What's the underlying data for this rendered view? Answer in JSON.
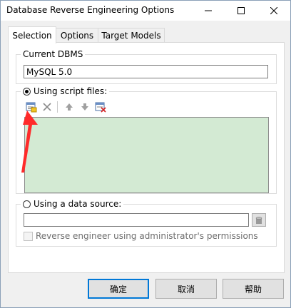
{
  "window": {
    "title": "Database Reverse Engineering Options"
  },
  "tabs": [
    {
      "label": "Selection"
    },
    {
      "label": "Options"
    },
    {
      "label": "Target Models"
    }
  ],
  "current_dbms": {
    "legend": "Current DBMS",
    "value": "MySQL 5.0"
  },
  "script_files": {
    "label": "Using script files:",
    "selected": true,
    "toolbar_icons": [
      "add-file-icon",
      "delete-icon",
      "move-up-icon",
      "move-down-icon",
      "clear-list-icon"
    ]
  },
  "data_source": {
    "label": "Using a data source:",
    "selected": false,
    "value": "",
    "admin_checkbox_label": "Reverse engineer using administrator's permissions",
    "admin_checked": false
  },
  "buttons": {
    "ok": "确定",
    "cancel": "取消",
    "help": "帮助"
  },
  "colors": {
    "script_list_bg": "#d3ead3",
    "annotation_arrow": "#ff2a2a",
    "default_button_border": "#0078d7"
  }
}
